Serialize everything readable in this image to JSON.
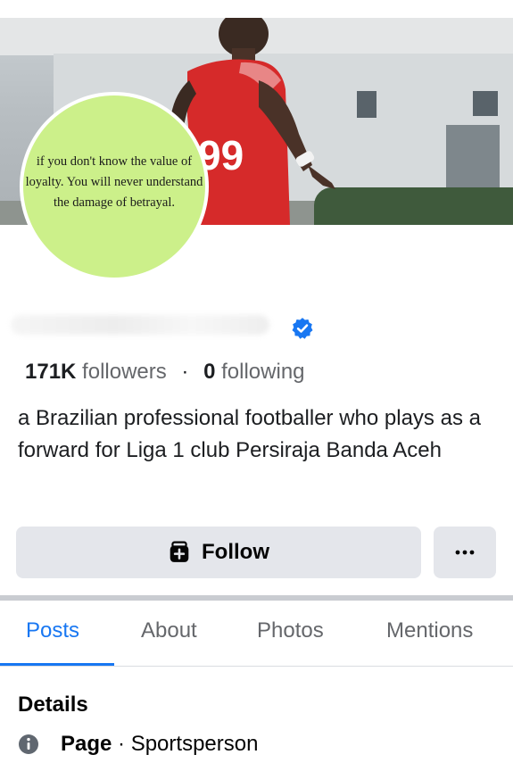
{
  "profile": {
    "avatar_quote": "if you don't know the value of loyalty. You will never understand the damage of betrayal.",
    "followers_count": "171K",
    "followers_label": "followers",
    "separator": "·",
    "following_count": "0",
    "following_label": "following",
    "bio": "a Brazilian professional footballer who plays as a forward for Liga 1 club Persiraja Banda Aceh",
    "jersey_number": "99"
  },
  "actions": {
    "follow_label": "Follow",
    "more_label": "···"
  },
  "tabs": [
    {
      "label": "Posts",
      "active": true
    },
    {
      "label": "About",
      "active": false
    },
    {
      "label": "Photos",
      "active": false
    },
    {
      "label": "Mentions",
      "active": false
    }
  ],
  "details": {
    "heading": "Details",
    "page_label": "Page",
    "page_separator": " · ",
    "category": "Sportsperson"
  },
  "colors": {
    "accent": "#1877f2",
    "avatar_bg": "#ccf08a",
    "button_bg": "#e4e6eb",
    "jersey": "#d62a2a"
  },
  "icons": {
    "verified": "verified-badge-icon",
    "follow": "add-friend-icon",
    "info": "info-icon"
  }
}
